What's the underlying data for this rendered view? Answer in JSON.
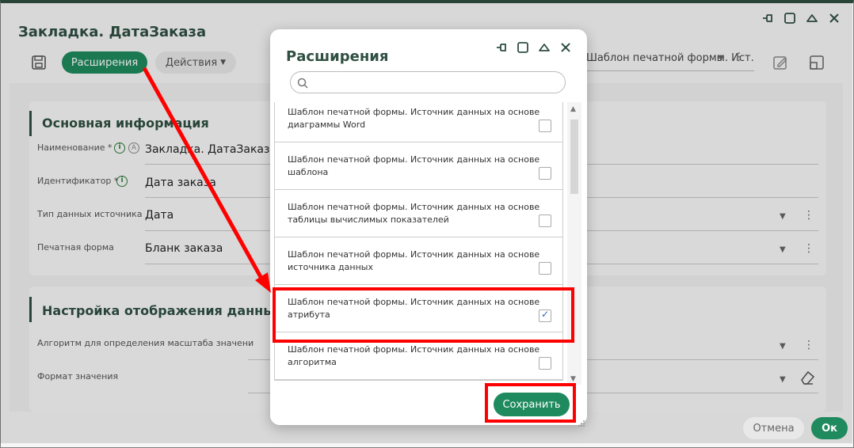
{
  "window": {
    "title": "Закладка. ДатаЗаказа"
  },
  "toolbar": {
    "extensions_label": "Расширения",
    "actions_label": "Действия",
    "combo_value": "Шаблон печатной формы. Ист..."
  },
  "main_section": {
    "title": "Основная информация",
    "fields": [
      {
        "label": "Наименование *",
        "value": "Закладка. ДатаЗаказа"
      },
      {
        "label": "Идентификатор *",
        "value": "Дата заказа"
      },
      {
        "label": "Тип данных источника",
        "value": "Дата"
      },
      {
        "label": "Печатная форма",
        "value": "Бланк заказа"
      }
    ]
  },
  "display_section": {
    "title": "Настройка отображения данных",
    "fields": [
      {
        "label": "Алгоритм для определения масштаба значени",
        "value": ""
      },
      {
        "label": "Формат значения",
        "value": ""
      }
    ]
  },
  "footer": {
    "cancel_label": "Отмена",
    "ok_label": "Ок"
  },
  "modal": {
    "title": "Расширения",
    "search_placeholder": "",
    "items": [
      {
        "label": "Шаблон печатной формы. Источник данных на основе диаграммы Word",
        "checked": false
      },
      {
        "label": "Шаблон печатной формы. Источник данных на основе шаблона",
        "checked": false
      },
      {
        "label": "Шаблон печатной формы. Источник данных на основе таблицы вычислимых показателей",
        "checked": false
      },
      {
        "label": "Шаблон печатной формы. Источник данных на основе источника данных",
        "checked": false
      },
      {
        "label": "Шаблон печатной формы. Источник данных на основе атрибута",
        "checked": true
      },
      {
        "label": "Шаблон печатной формы. Источник данных на основе алгоритма",
        "checked": false
      }
    ],
    "save_label": "Сохранить"
  },
  "colors": {
    "primary": "#1f8a5e",
    "title_text": "#2f4f42",
    "annotation": "#ff0000",
    "check": "#2a66c9"
  },
  "icons": [
    "save-icon",
    "pin-icon",
    "maximize-icon",
    "collapse-icon",
    "close-icon",
    "edit-icon",
    "window-icon",
    "info-icon",
    "search-icon",
    "chevron-down-icon",
    "kebab-icon",
    "eraser-icon"
  ]
}
